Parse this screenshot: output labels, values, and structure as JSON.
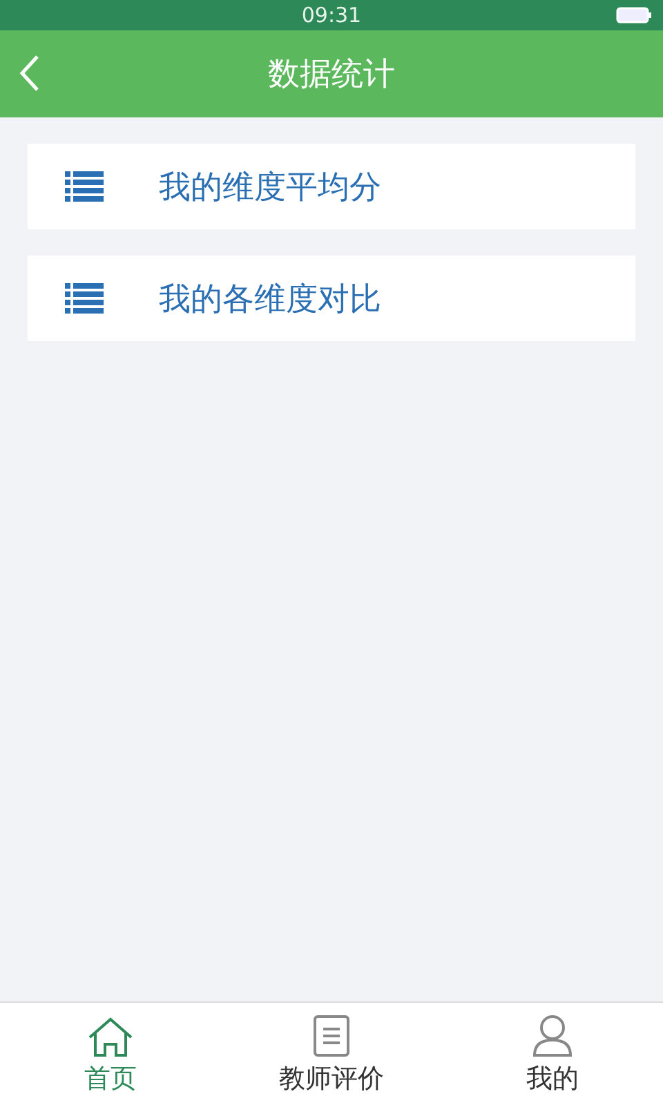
{
  "status_bar": {
    "time": "09:31"
  },
  "header": {
    "title": "数据统计"
  },
  "items": [
    {
      "label": "我的维度平均分"
    },
    {
      "label": "我的各维度对比"
    }
  ],
  "tabs": [
    {
      "label": "首页",
      "kind": "home",
      "selected": true
    },
    {
      "label": "教师评价",
      "kind": "clipboard",
      "selected": false
    },
    {
      "label": "我的",
      "kind": "person",
      "selected": false
    }
  ]
}
